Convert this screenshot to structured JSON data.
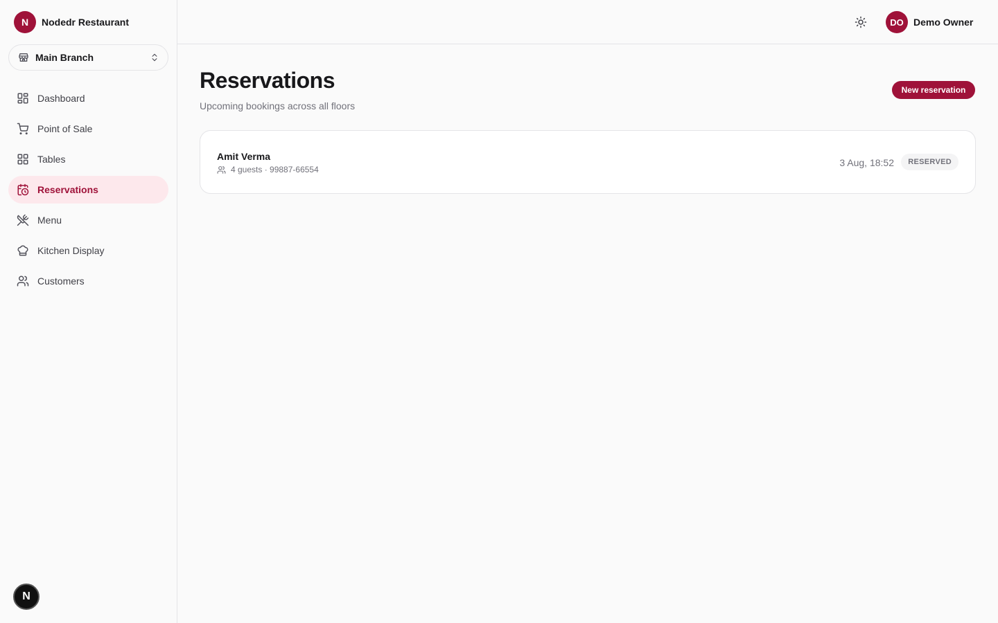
{
  "brand": {
    "logo_letter": "N",
    "name": "Nodedr Restaurant"
  },
  "branch": {
    "label": "Main Branch",
    "icon": "store-icon"
  },
  "nav": {
    "items": [
      {
        "label": "Dashboard",
        "icon": "dashboard-icon"
      },
      {
        "label": "Point of Sale",
        "icon": "cart-icon"
      },
      {
        "label": "Tables",
        "icon": "grid-icon"
      },
      {
        "label": "Reservations",
        "icon": "calendar-clock-icon",
        "active": true
      },
      {
        "label": "Menu",
        "icon": "utensils-icon"
      },
      {
        "label": "Kitchen Display",
        "icon": "chef-hat-icon"
      },
      {
        "label": "Customers",
        "icon": "users-icon"
      }
    ]
  },
  "corner_badge": {
    "letter": "N"
  },
  "header": {
    "theme_icon": "sun-icon",
    "user": {
      "initials": "DO",
      "name": "Demo Owner"
    }
  },
  "page": {
    "title": "Reservations",
    "subtitle": "Upcoming bookings across all floors",
    "new_button_label": "New reservation"
  },
  "reservations": [
    {
      "name": "Amit Verma",
      "meta": "4 guests · 99887-66554",
      "time": "3 Aug, 18:52",
      "status": "RESERVED"
    }
  ],
  "colors": {
    "accent": "#9f1239",
    "active_bg": "#fde8ec",
    "border": "#e4e4e7",
    "muted_text": "#71717a"
  }
}
